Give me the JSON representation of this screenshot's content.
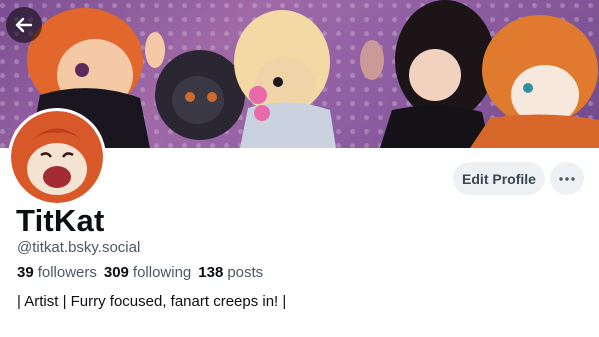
{
  "profile": {
    "display_name": "TitKat",
    "handle": "@titkat.bsky.social",
    "followers_count": "39",
    "followers_label": "followers",
    "following_count": "309",
    "following_label": "following",
    "posts_count": "138",
    "posts_label": "posts",
    "bio": "| Artist | Furry focused, fanart creeps in! |"
  },
  "actions": {
    "edit_profile_label": "Edit Profile"
  },
  "icons": {
    "back": "arrow-left-icon",
    "more": "ellipsis-icon"
  },
  "colors": {
    "button_bg": "#eef1f4",
    "muted_text": "#4c5867",
    "primary_text": "#0b0f14"
  }
}
